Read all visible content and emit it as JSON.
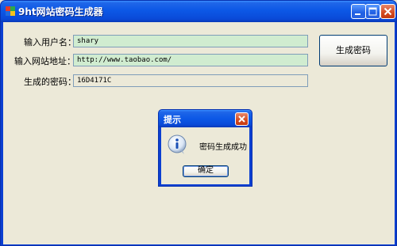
{
  "window": {
    "title": "9ht网站密码生成器"
  },
  "form": {
    "username_label": "输入用户名：",
    "username_value": "shary",
    "website_label": "输入网站地址：",
    "website_value": "http://www.taobao.com/",
    "password_label": "生成的密码：",
    "password_value": "16D4171C",
    "generate_button": "生成密码"
  },
  "dialog": {
    "title": "提示",
    "message": "密码生成成功",
    "ok_button": "确定"
  },
  "colors": {
    "titlebar_blue": "#0c58e6",
    "input_green": "#d0ecd0",
    "window_bg": "#ece9d8",
    "close_red": "#d44a20"
  }
}
